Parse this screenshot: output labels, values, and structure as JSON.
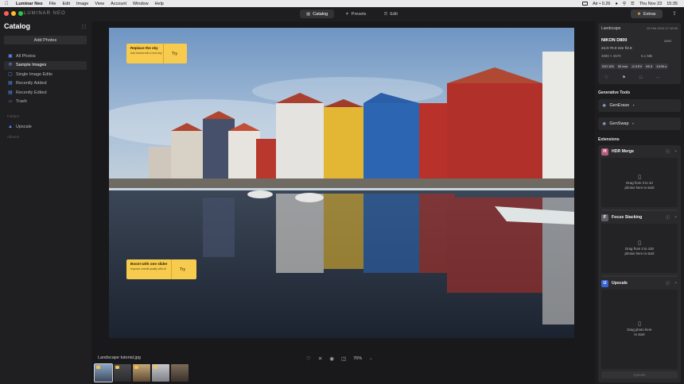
{
  "menubar": {
    "app_name": "Luminar Neo",
    "items": [
      "File",
      "Edit",
      "Image",
      "View",
      "Account",
      "Window",
      "Help"
    ],
    "status_network": "Air • 0.26",
    "date": "Thu Nov 23",
    "time": "15:35"
  },
  "window": {
    "brand": "LUMINAR NEO",
    "nav": [
      {
        "label": "Catalog",
        "icon": "catalog-icon"
      },
      {
        "label": "Presets",
        "icon": "presets-icon"
      },
      {
        "label": "Edit",
        "icon": "edit-icon"
      }
    ],
    "extras_label": "Extras"
  },
  "sidebar": {
    "title": "Catalog",
    "add_photos": "Add Photos",
    "items": [
      {
        "label": "All Photos",
        "icon": "photos-icon"
      },
      {
        "label": "Sample Images",
        "icon": "sample-icon"
      },
      {
        "label": "Single Image Edits",
        "icon": "single-edit-icon"
      },
      {
        "label": "Recently Added",
        "icon": "recent-added-icon"
      },
      {
        "label": "Recently Edited",
        "icon": "recent-edited-icon"
      },
      {
        "label": "Trash",
        "icon": "trash-icon"
      }
    ],
    "section_folders": "Folders",
    "upscale_label": "Upscale",
    "section_albums": "Albums"
  },
  "tips": [
    {
      "title": "Replace the sky",
      "subtitle": "Add drama with a new sky",
      "action": "Try"
    },
    {
      "title": "Boost with one slider",
      "subtitle": "Improve overall quality with AI",
      "action": "Try"
    }
  ],
  "bottom": {
    "filename": "Landscape tutorial.jpg",
    "zoom": "76%"
  },
  "info": {
    "title": "Landscape",
    "date": "10 Feb 2010 17:10:00",
    "camera": "NIKON D800",
    "format": "AWB",
    "lens": "24.0-70.0 mm f/2.8",
    "dimensions": "4000 × 2670",
    "filesize": "5.1 MB",
    "exif": [
      "ISO 100",
      "32 mm",
      "-0.3 EV",
      "f/6.3",
      "1/100 s"
    ]
  },
  "generative": {
    "title": "Generative Tools",
    "tools": [
      {
        "label": "GenErase",
        "sup": "✦"
      },
      {
        "label": "GenSwap",
        "sup": "✦"
      }
    ]
  },
  "extensions": {
    "title": "Extensions",
    "cards": [
      {
        "name": "HDR Merge",
        "logo": "H",
        "logo_color": "#b45b78",
        "drop_line1": "Drag from 3 to 10",
        "drop_line2": "photos here to start",
        "button": "Merge"
      },
      {
        "name": "Focus Stacking",
        "logo": "F",
        "logo_color": "#5f5f66",
        "drop_line1": "Drag from 3 to 100",
        "drop_line2": "photos here to start",
        "button": "Merge"
      },
      {
        "name": "Upscale",
        "logo": "U",
        "logo_color": "#3a63d6",
        "drop_line1": "Drag photo here",
        "drop_line2": "to start",
        "button": "Upscale"
      }
    ]
  },
  "colors": {
    "accent_blue": "#5a8cff",
    "tip_yellow": "#f7cb4d",
    "background": "#1b1b1d"
  }
}
